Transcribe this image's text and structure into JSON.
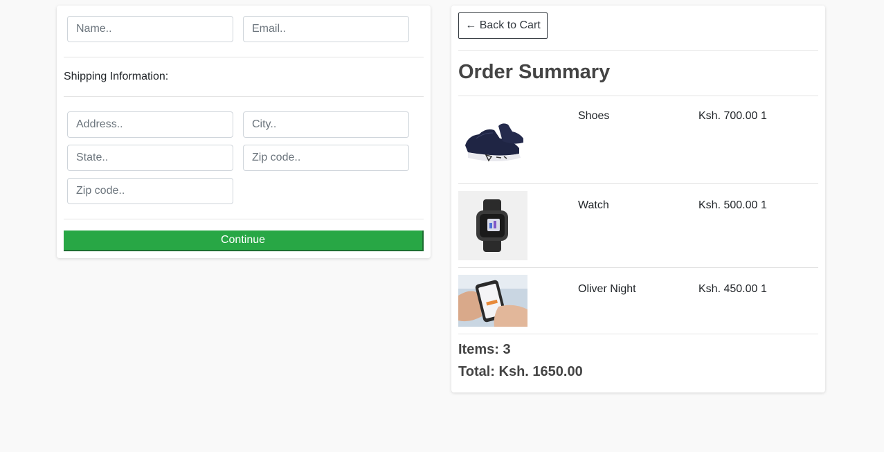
{
  "checkout_form": {
    "name_placeholder": "Name..",
    "email_placeholder": "Email..",
    "shipping_heading": "Shipping Information:",
    "address_placeholder": "Address..",
    "city_placeholder": "City..",
    "state_placeholder": "State..",
    "zip_placeholder": "Zip code..",
    "zip2_placeholder": "Zip code..",
    "continue_label": "Continue",
    "accent_color": "#28a745"
  },
  "summary": {
    "back_label": "← Back to Cart",
    "title": "Order Summary",
    "items": [
      {
        "name": "Shoes",
        "price": "Ksh. 700.00",
        "qty": "1",
        "image": "sneaker-image"
      },
      {
        "name": "Watch",
        "price": "Ksh. 500.00",
        "qty": "1",
        "image": "smartwatch-image"
      },
      {
        "name": "Oliver Night",
        "price": "Ksh. 450.00",
        "qty": "1",
        "image": "phone-in-hand-image"
      }
    ],
    "items_count": "Items: 3",
    "total": "Total: Ksh. 1650.00"
  }
}
